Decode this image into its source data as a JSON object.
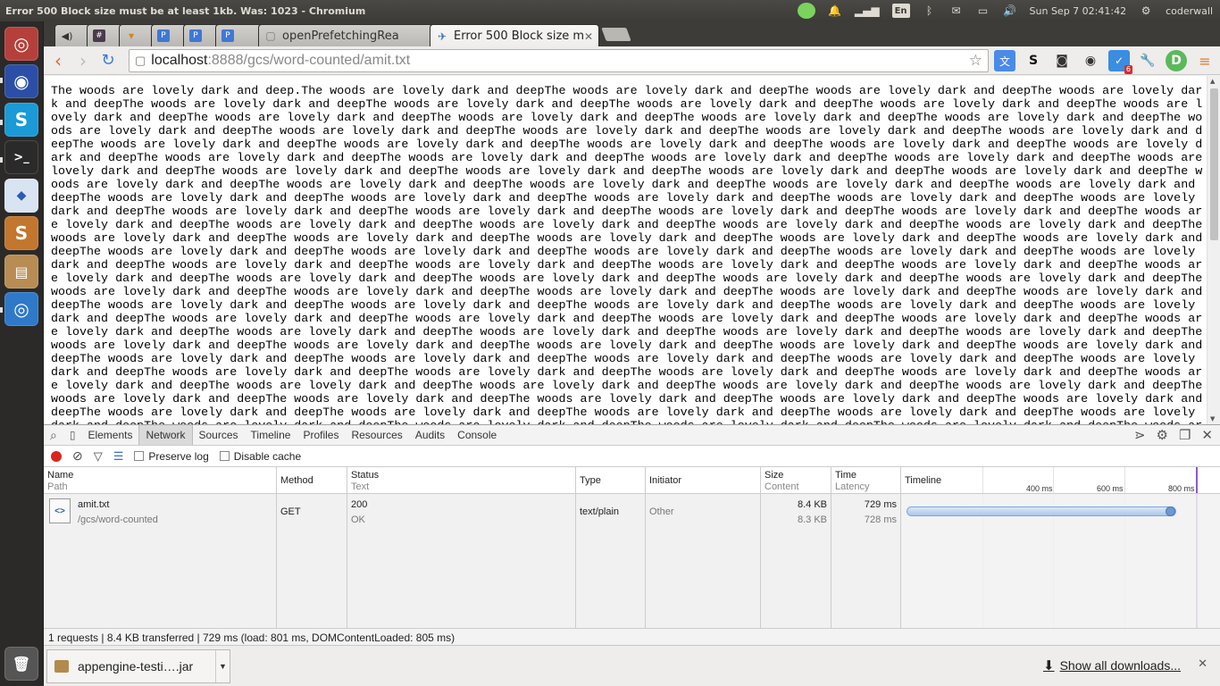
{
  "window": {
    "title": "Error 500 Block size must be at least 1kb. Was: 1023 - Chromium"
  },
  "panel": {
    "language": "En",
    "datetime": "Sun Sep  7 02:41:42",
    "user": "coderwall"
  },
  "tabs": [
    {
      "label": "",
      "favicon": "speaker-icon"
    },
    {
      "label": "",
      "favicon": "slack-icon"
    },
    {
      "label": "",
      "favicon": "lamp-icon"
    },
    {
      "label": "",
      "favicon": "pivotal-icon"
    },
    {
      "label": "",
      "favicon": "pivotal-icon"
    },
    {
      "label": "",
      "favicon": "pivotal-icon"
    },
    {
      "label": "openPrefetchingRea",
      "favicon": "page-icon"
    },
    {
      "label": "Error 500 Block size m",
      "favicon": "appengine-icon",
      "active": true
    }
  ],
  "address": {
    "host": "localhost",
    "rest": ":8888/gcs/word-counted/amit.txt"
  },
  "extensions": {
    "badge": "6"
  },
  "page": {
    "text": "The woods are lovely dark and deep.The woods are lovely dark and deepThe woods are lovely dark and deepThe woods are lovely dark and deepThe woods are lovely dark and deepThe woods are lovely dark and deepThe woods are lovely dark and deepThe woods are lovely dark and deepThe woods are lovely dark and deepThe woods are lovely dark and deepThe woods are lovely dark and deepThe woods are lovely dark and deepThe woods are lovely dark and deepThe woods are lovely dark and deepThe woods are lovely dark and deepThe woods are lovely dark and deepThe woods are lovely dark and deepThe woods are lovely dark and deepThe woods are lovely dark and deepThe woods are lovely dark and deepThe woods are lovely dark and deepThe woods are lovely dark and deepThe woods are lovely dark and deepThe woods are lovely dark and deepThe woods are lovely dark and deepThe woods are lovely dark and deepThe woods are lovely dark and deepThe woods are lovely dark and deepThe woods are lovely dark and deepThe woods are lovely dark and deepThe woods are lovely dark and deepThe woods are lovely dark and deepThe woods are lovely dark and deepThe woods are lovely dark and deepThe woods are lovely dark and deepThe woods are lovely dark and deepThe woods are lovely dark and deepThe woods are lovely dark and deepThe woods are lovely dark and deepThe woods are lovely dark and deepThe woods are lovely dark and deepThe woods are lovely dark and deepThe woods are lovely dark and deepThe woods are lovely dark and deepThe woods are lovely dark and deepThe woods are lovely dark and deepThe woods are lovely dark and deepThe woods are lovely dark and deepThe woods are lovely dark and deepThe woods are lovely dark and deepThe woods are lovely dark and deepThe woods are lovely dark and deepThe woods are lovely dark and deepThe woods are lovely dark and deepThe woods are lovely dark and deepThe woods are lovely dark and deepThe woods are lovely dark and deepThe woods are lovely dark and deepThe woods are lovely dark and deepThe woods are lovely dark and deepThe woods are lovely dark and deepThe woods are lovely dark and deepThe woods are lovely dark and deepThe woods are lovely dark and deepThe woods are lovely dark and deepThe woods are lovely dark and deepThe woods are lovely dark and deepThe woods are lovely dark and deepThe woods are lovely dark and deepThe woods are lovely dark and deepThe woods are lovely dark and deepThe woods are lovely dark and deepThe woods are lovely dark and deepThe woods are lovely dark and deepThe woods are lovely dark and deepThe woods are lovely dark and deepThe woods are lovely dark and deepThe woods are lovely dark and deepThe woods are lovely dark and deepThe woods are lovely dark and deepThe woods are lovely dark and deepThe woods are lovely dark and deepThe woods are lovely dark and deepThe woods are lovely dark and deepThe woods are lovely dark and deepThe woods are lovely dark and deepThe woods are lovely dark and deepThe woods are lovely dark and deepThe woods are lovely dark and deepThe woods are lovely dark and deepThe woods are lovely dark and deepThe woods are lovely dark and deepThe woods are lovely dark and deepThe woods are lovely dark and deepThe woods are lovely dark and deepThe woods are lovely dark and deepThe woods are lovely dark and deepThe woods are lovely dark and deepThe woods are lovely dark and deepThe woods are lovely dark and deepThe woods are lovely dark and deepThe woods are lovely dark and deepThe woods are lovely dark and deepThe woods are lovely dark and deepThe woods are lovely dark and deepThe woods are lovely dark and deepThe woods are lovely dark and deepThe woods are lovely dark and deepThe woods are lovely dark and deepThe woods are lovely dark and deepThe woods are lovely dark and deepThe woods are lovely dark and deepThe woods are lovely dark and deepThe woods are lovely dark and deepThe woods are lovely dark and deepThe woods are lovely dark and deepThe woods are lovely dark and deepThe woods are lovely dark and deepThe woods are lovely dark and deepThe woods are lovely dark and deepThe woods are lovely dark and deepThe woods are lovely dark and deepThe woods are lovely dark and deepThe woods are lovely dark and deepThe woods are lovely dark and deepThe woods are lovely dark and deepThe woods are lovely dark and deepThe woods are lovely dark and deepThe woods are lovely dark and deepThe woods are lovely dark and deepThe woods are lovely dark and deepThe woods are lovely dark and deepThe woods are lovely dark and deepThe woods are lovely dark and deepThe woods are lovely dark and deepThe woods are lovely dark and deepThe woods are lovely dark and deepThe woods are lovely dark and deepThe woods are lovely dark and deepThe woods are lovely dark and deepThe woods are lovely dark and deepThe woods are lovely dark and deepThe woods are lovely dark and deepThe woods are lovely dark and deepThe woods are lovely dark and deepThe woods are lovely dark and deepThe woods are lovely dark and deepThe woods are lovely dark and deepThe woods are lovely dark and deepThe woods are lovely dark and deepThe woods are lovely dark and deepThe woods are lovely dark and deepThe woods are lovely dark and deepThe woods are lovely dark and deepThe woods are lovely dark and deepThe woods are lovely dark and deepThe woods are lovely dark and deepThe woods are lovely dark and deepThe woods are lovely dark and deepThe woods are lovely dark and deepThe woods are lovely dark and deepThe woods are lovely dark and deepThe woods are lovely dark and deepThe woods are lovely dark and deepThe woods are lovely dark and deepThe woods are lovely dark and deepThe woods are lovely dark and deepThe woods are lovely dark and deepThe woods are lovely dark and deepThe woods are lovely dark and deepThe woods are lovely dark and deepThe woods are lovely dark and deepThe woods are lovely dark and deepThe woods are lovely dark and deepThe woods are lovely dark and deepThe woods are lovely dark and deepThe woods are lovely dark and deepThe woods are lovely dark and deepThe woods are lovely dark and deepThe woods are lovely dark and deepThe woods are lovely dark and deepThe woods are lovely dark and deepThe woods are lovely dark and deepThe woods are lovely dark and deepThe woods are lovely dark and deepThe woods are lovely dark and deepThe woods are lovely dark and deepThe woods are lovely dark and deepThe woods are lovely dark and deepThe woods are lovely dark and deepThe woods are lovely dark and deepThe woods are lovely dark and deepThe woods are lovely dark and deepThe woods are lovely dark and deepThe woods are lovely dark and deepThe woods are lovely dark and deepThe woods are lovely dark and deepThe woods are lovely dark and deepThe woods are lovely dark and deepThe woods are lovely dark and deepThe woods are lovely dark and deepThe woods are lovely dark and deepThe woods are lovely dark and deepThe woods are lovely dark and deepThe woods are lovely dark and deepThe woods are lovely dark and deepThe woods are lovely dark and deepThe woods are lovely dark and deepThe woods are lovely dark and deepThe woods are lovely dark and deepThe woods are lovely dark and deep"
  },
  "devtools": {
    "tabs": [
      "Elements",
      "Network",
      "Sources",
      "Timeline",
      "Profiles",
      "Resources",
      "Audits",
      "Console"
    ],
    "selected_tab": "Network",
    "filters": {
      "preserve_log": "Preserve log",
      "disable_cache": "Disable cache"
    },
    "columns": {
      "name": "Name",
      "name_sub": "Path",
      "method": "Method",
      "status": "Status",
      "status_sub": "Text",
      "type": "Type",
      "initiator": "Initiator",
      "size": "Size",
      "size_sub": "Content",
      "time": "Time",
      "time_sub": "Latency",
      "timeline": "Timeline"
    },
    "timeline_ticks": [
      "400 ms",
      "600 ms",
      "800 ms"
    ],
    "row": {
      "name": "amit.txt",
      "path": "/gcs/word-counted",
      "method": "GET",
      "status": "200",
      "status_text": "OK",
      "type": "text/plain",
      "initiator": "Other",
      "size": "8.4 KB",
      "content": "8.3 KB",
      "time": "729 ms",
      "latency": "728 ms"
    },
    "status_bar": "1 requests  |  8.4 KB transferred  |  729 ms (load: 801 ms, DOMContentLoaded: 805 ms)"
  },
  "downloads": {
    "item": "appengine-testi….jar",
    "show_all": "Show all downloads..."
  },
  "colors": {
    "accent_red": "#d9261c",
    "timeline_blue": "#7fa7d8",
    "ubuntu_panel": "#3c3b37"
  }
}
